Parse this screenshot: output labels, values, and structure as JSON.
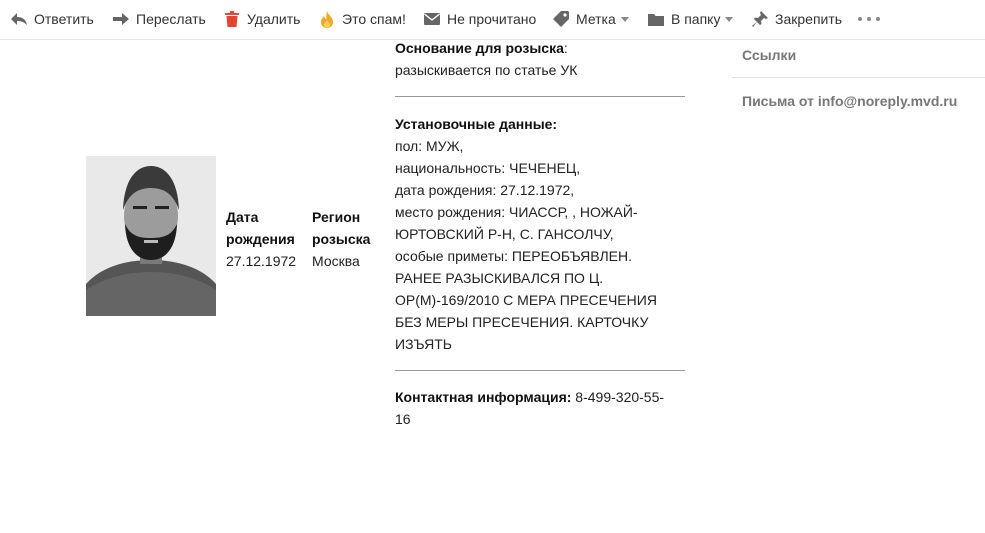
{
  "toolbar": {
    "reply": "Ответить",
    "forward": "Переслать",
    "delete": "Удалить",
    "spam": "Это спам!",
    "unread": "Не прочитано",
    "label": "Метка",
    "folder": "В папку",
    "pin": "Закрепить"
  },
  "person": {
    "dob_header_1": "Дата",
    "dob_header_2": "рождения",
    "dob_value": "27.12.1972",
    "region_header_1": "Регион",
    "region_header_2": "розыска",
    "region_value": "Москва"
  },
  "details": {
    "basis_title": "Основание для розыска",
    "basis_colon": ":",
    "basis_text": "разыскивается по статье УК",
    "setup_title": "Установочные данные:",
    "lines": [
      "пол: МУЖ,",
      "национальность: ЧЕЧЕНЕЦ,",
      "дата рождения: 27.12.1972,",
      "место рождения: ЧИАССР, , НОЖАЙ-",
      "ЮРТОВСКИЙ Р-Н, С. ГАНСОЛЧУ,",
      "особые приметы: ПЕРЕОБЪЯВЛЕН.",
      "РАНЕЕ РАЗЫСКИВАЛСЯ ПО Ц.",
      "ОР(М)-169/2010 С МЕРА ПРЕСЕЧЕНИЯ",
      "БЕЗ МЕРЫ ПРЕСЕЧЕНИЯ. КАРТОЧКУ",
      "ИЗЪЯТЬ"
    ],
    "contact_title": "Контактная информация:",
    "contact_value_1": " 8-499-320-55-",
    "contact_value_2": "16"
  },
  "sidebar": {
    "links": "Ссылки",
    "letters_from": "Письма от info@noreply.mvd.ru"
  },
  "colors": {
    "delete_icon": "#e8432e",
    "spam_icon": "#f5a623",
    "icon_gray": "#666666"
  }
}
